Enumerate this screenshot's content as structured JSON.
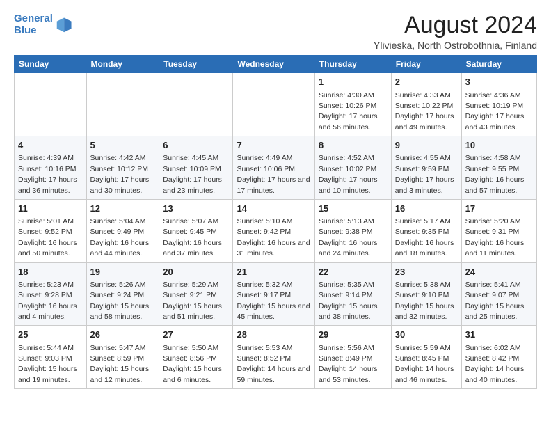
{
  "logo": {
    "line1": "General",
    "line2": "Blue",
    "icon_color": "#3a7bbf"
  },
  "title": "August 2024",
  "subtitle": "Ylivieska, North Ostrobothnia, Finland",
  "header": {
    "accent": "#2a6db5"
  },
  "weekdays": [
    "Sunday",
    "Monday",
    "Tuesday",
    "Wednesday",
    "Thursday",
    "Friday",
    "Saturday"
  ],
  "weeks": [
    [
      {
        "day": "",
        "sunrise": "",
        "sunset": "",
        "daylight": ""
      },
      {
        "day": "",
        "sunrise": "",
        "sunset": "",
        "daylight": ""
      },
      {
        "day": "",
        "sunrise": "",
        "sunset": "",
        "daylight": ""
      },
      {
        "day": "",
        "sunrise": "",
        "sunset": "",
        "daylight": ""
      },
      {
        "day": "1",
        "sunrise": "Sunrise: 4:30 AM",
        "sunset": "Sunset: 10:26 PM",
        "daylight": "Daylight: 17 hours and 56 minutes."
      },
      {
        "day": "2",
        "sunrise": "Sunrise: 4:33 AM",
        "sunset": "Sunset: 10:22 PM",
        "daylight": "Daylight: 17 hours and 49 minutes."
      },
      {
        "day": "3",
        "sunrise": "Sunrise: 4:36 AM",
        "sunset": "Sunset: 10:19 PM",
        "daylight": "Daylight: 17 hours and 43 minutes."
      }
    ],
    [
      {
        "day": "4",
        "sunrise": "Sunrise: 4:39 AM",
        "sunset": "Sunset: 10:16 PM",
        "daylight": "Daylight: 17 hours and 36 minutes."
      },
      {
        "day": "5",
        "sunrise": "Sunrise: 4:42 AM",
        "sunset": "Sunset: 10:12 PM",
        "daylight": "Daylight: 17 hours and 30 minutes."
      },
      {
        "day": "6",
        "sunrise": "Sunrise: 4:45 AM",
        "sunset": "Sunset: 10:09 PM",
        "daylight": "Daylight: 17 hours and 23 minutes."
      },
      {
        "day": "7",
        "sunrise": "Sunrise: 4:49 AM",
        "sunset": "Sunset: 10:06 PM",
        "daylight": "Daylight: 17 hours and 17 minutes."
      },
      {
        "day": "8",
        "sunrise": "Sunrise: 4:52 AM",
        "sunset": "Sunset: 10:02 PM",
        "daylight": "Daylight: 17 hours and 10 minutes."
      },
      {
        "day": "9",
        "sunrise": "Sunrise: 4:55 AM",
        "sunset": "Sunset: 9:59 PM",
        "daylight": "Daylight: 17 hours and 3 minutes."
      },
      {
        "day": "10",
        "sunrise": "Sunrise: 4:58 AM",
        "sunset": "Sunset: 9:55 PM",
        "daylight": "Daylight: 16 hours and 57 minutes."
      }
    ],
    [
      {
        "day": "11",
        "sunrise": "Sunrise: 5:01 AM",
        "sunset": "Sunset: 9:52 PM",
        "daylight": "Daylight: 16 hours and 50 minutes."
      },
      {
        "day": "12",
        "sunrise": "Sunrise: 5:04 AM",
        "sunset": "Sunset: 9:49 PM",
        "daylight": "Daylight: 16 hours and 44 minutes."
      },
      {
        "day": "13",
        "sunrise": "Sunrise: 5:07 AM",
        "sunset": "Sunset: 9:45 PM",
        "daylight": "Daylight: 16 hours and 37 minutes."
      },
      {
        "day": "14",
        "sunrise": "Sunrise: 5:10 AM",
        "sunset": "Sunset: 9:42 PM",
        "daylight": "Daylight: 16 hours and 31 minutes."
      },
      {
        "day": "15",
        "sunrise": "Sunrise: 5:13 AM",
        "sunset": "Sunset: 9:38 PM",
        "daylight": "Daylight: 16 hours and 24 minutes."
      },
      {
        "day": "16",
        "sunrise": "Sunrise: 5:17 AM",
        "sunset": "Sunset: 9:35 PM",
        "daylight": "Daylight: 16 hours and 18 minutes."
      },
      {
        "day": "17",
        "sunrise": "Sunrise: 5:20 AM",
        "sunset": "Sunset: 9:31 PM",
        "daylight": "Daylight: 16 hours and 11 minutes."
      }
    ],
    [
      {
        "day": "18",
        "sunrise": "Sunrise: 5:23 AM",
        "sunset": "Sunset: 9:28 PM",
        "daylight": "Daylight: 16 hours and 4 minutes."
      },
      {
        "day": "19",
        "sunrise": "Sunrise: 5:26 AM",
        "sunset": "Sunset: 9:24 PM",
        "daylight": "Daylight: 15 hours and 58 minutes."
      },
      {
        "day": "20",
        "sunrise": "Sunrise: 5:29 AM",
        "sunset": "Sunset: 9:21 PM",
        "daylight": "Daylight: 15 hours and 51 minutes."
      },
      {
        "day": "21",
        "sunrise": "Sunrise: 5:32 AM",
        "sunset": "Sunset: 9:17 PM",
        "daylight": "Daylight: 15 hours and 45 minutes."
      },
      {
        "day": "22",
        "sunrise": "Sunrise: 5:35 AM",
        "sunset": "Sunset: 9:14 PM",
        "daylight": "Daylight: 15 hours and 38 minutes."
      },
      {
        "day": "23",
        "sunrise": "Sunrise: 5:38 AM",
        "sunset": "Sunset: 9:10 PM",
        "daylight": "Daylight: 15 hours and 32 minutes."
      },
      {
        "day": "24",
        "sunrise": "Sunrise: 5:41 AM",
        "sunset": "Sunset: 9:07 PM",
        "daylight": "Daylight: 15 hours and 25 minutes."
      }
    ],
    [
      {
        "day": "25",
        "sunrise": "Sunrise: 5:44 AM",
        "sunset": "Sunset: 9:03 PM",
        "daylight": "Daylight: 15 hours and 19 minutes."
      },
      {
        "day": "26",
        "sunrise": "Sunrise: 5:47 AM",
        "sunset": "Sunset: 8:59 PM",
        "daylight": "Daylight: 15 hours and 12 minutes."
      },
      {
        "day": "27",
        "sunrise": "Sunrise: 5:50 AM",
        "sunset": "Sunset: 8:56 PM",
        "daylight": "Daylight: 15 hours and 6 minutes."
      },
      {
        "day": "28",
        "sunrise": "Sunrise: 5:53 AM",
        "sunset": "Sunset: 8:52 PM",
        "daylight": "Daylight: 14 hours and 59 minutes."
      },
      {
        "day": "29",
        "sunrise": "Sunrise: 5:56 AM",
        "sunset": "Sunset: 8:49 PM",
        "daylight": "Daylight: 14 hours and 53 minutes."
      },
      {
        "day": "30",
        "sunrise": "Sunrise: 5:59 AM",
        "sunset": "Sunset: 8:45 PM",
        "daylight": "Daylight: 14 hours and 46 minutes."
      },
      {
        "day": "31",
        "sunrise": "Sunrise: 6:02 AM",
        "sunset": "Sunset: 8:42 PM",
        "daylight": "Daylight: 14 hours and 40 minutes."
      }
    ]
  ]
}
